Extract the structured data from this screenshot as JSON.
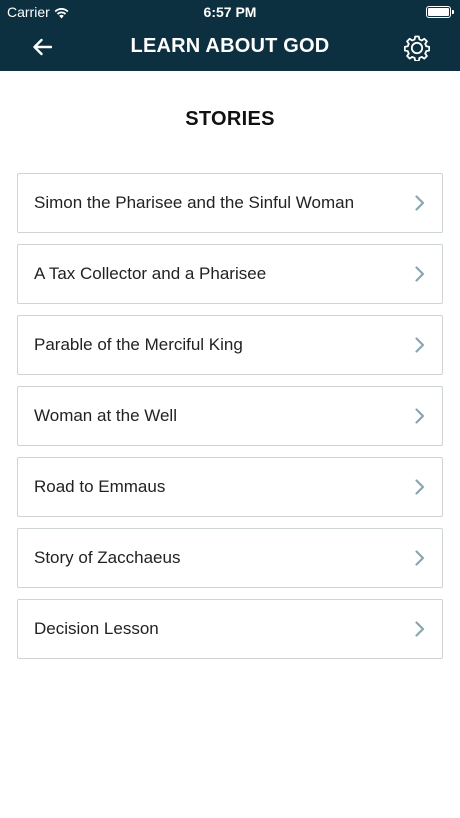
{
  "status_bar": {
    "carrier": "Carrier",
    "time": "6:57 PM",
    "battery_level": 1.0
  },
  "header": {
    "title": "LEARN ABOUT GOD",
    "back_icon": "back-arrow-icon",
    "settings_icon": "gear-icon"
  },
  "section": {
    "title": "STORIES"
  },
  "stories": [
    {
      "label": "Simon the Pharisee and the Sinful Woman"
    },
    {
      "label": "A Tax Collector and a Pharisee"
    },
    {
      "label": "Parable of the Merciful King"
    },
    {
      "label": "Woman at the Well"
    },
    {
      "label": "Road to Emmaus"
    },
    {
      "label": "Story of Zacchaeus"
    },
    {
      "label": "Decision Lesson"
    }
  ],
  "colors": {
    "header_background": "#0c3040",
    "chevron": "#8aa6b0",
    "card_border": "#cfd4d6"
  }
}
